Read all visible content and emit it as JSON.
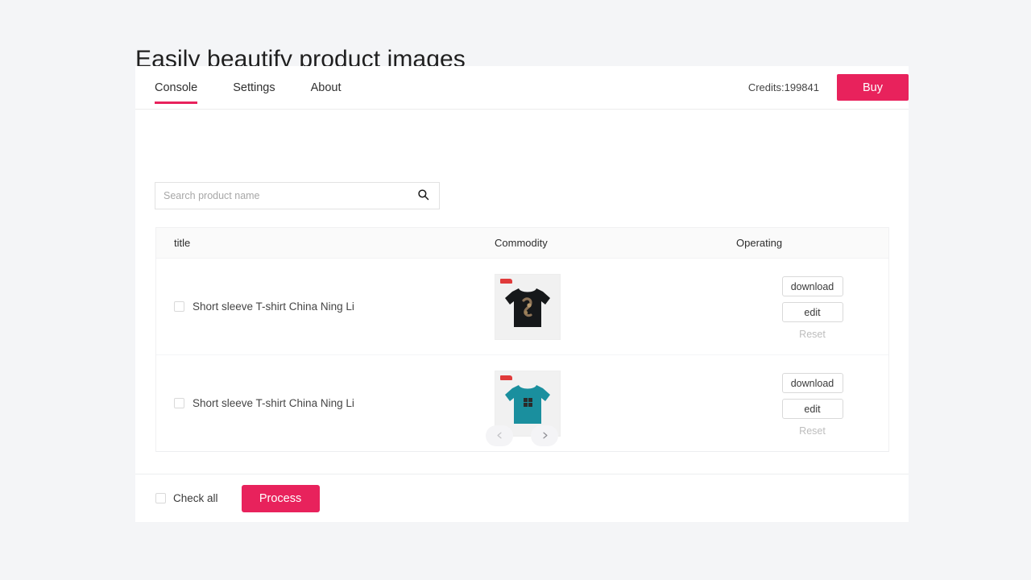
{
  "page": {
    "title": "Easily beautify product images",
    "background_color": "#f4f5f7",
    "accent_color": "#e8225c"
  },
  "navbar": {
    "tabs": [
      {
        "label": "Console",
        "active": true
      },
      {
        "label": "Settings",
        "active": false
      },
      {
        "label": "About",
        "active": false
      }
    ],
    "credits_label": "Credits:199841",
    "buy_label": "Buy"
  },
  "search": {
    "placeholder": "Search product name",
    "value": "",
    "icon": "search-icon"
  },
  "table": {
    "columns": [
      "title",
      "Commodity",
      "Operating"
    ],
    "rows": [
      {
        "checked": false,
        "title": "Short sleeve T-shirt China Ning Li",
        "thumbnail_alt": "black t-shirt with graphic print",
        "shirt_color": "#16181a",
        "actions": {
          "download": "download",
          "edit": "edit",
          "reset": "Reset"
        }
      },
      {
        "checked": false,
        "title": "Short sleeve T-shirt China Ning Li",
        "thumbnail_alt": "teal t-shirt with square graphic",
        "shirt_color": "#1a8f9e",
        "actions": {
          "download": "download",
          "edit": "edit",
          "reset": "Reset"
        }
      }
    ]
  },
  "pagination": {
    "prev_icon": "chevron-left-icon",
    "next_icon": "chevron-right-icon"
  },
  "footer": {
    "check_all_label": "Check all",
    "check_all_checked": false,
    "process_label": "Process"
  }
}
